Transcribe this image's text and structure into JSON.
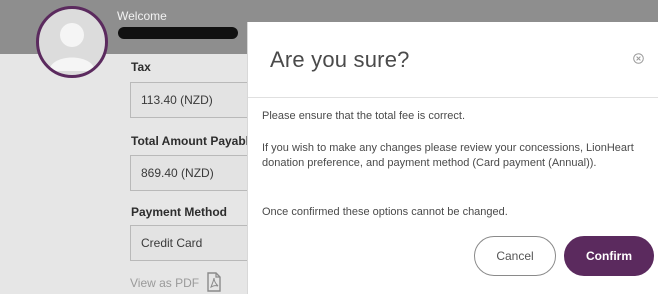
{
  "header": {
    "welcome_label": "Welcome"
  },
  "fields": {
    "tax": {
      "label": "Tax",
      "value": "113.40 (NZD)"
    },
    "total": {
      "label": "Total Amount Payable",
      "value": "869.40 (NZD)"
    },
    "payment": {
      "label": "Payment Method",
      "value": "Credit Card"
    }
  },
  "view_pdf_label": "View as PDF",
  "modal": {
    "title": "Are you sure?",
    "message1": "Please ensure that the total fee is correct.",
    "message2": "If you wish to make any changes please review your concessions, LionHeart donation preference, and payment method (Card payment (Annual)).",
    "message3": "Once confirmed these options cannot be changed.",
    "cancel_label": "Cancel",
    "confirm_label": "Confirm"
  },
  "colors": {
    "accent": "#5b2a5e",
    "overlay": "#8e8e8e"
  },
  "icons": {
    "avatar": "user-avatar-icon",
    "pdf": "pdf-file-icon",
    "close": "close-circle-icon"
  }
}
